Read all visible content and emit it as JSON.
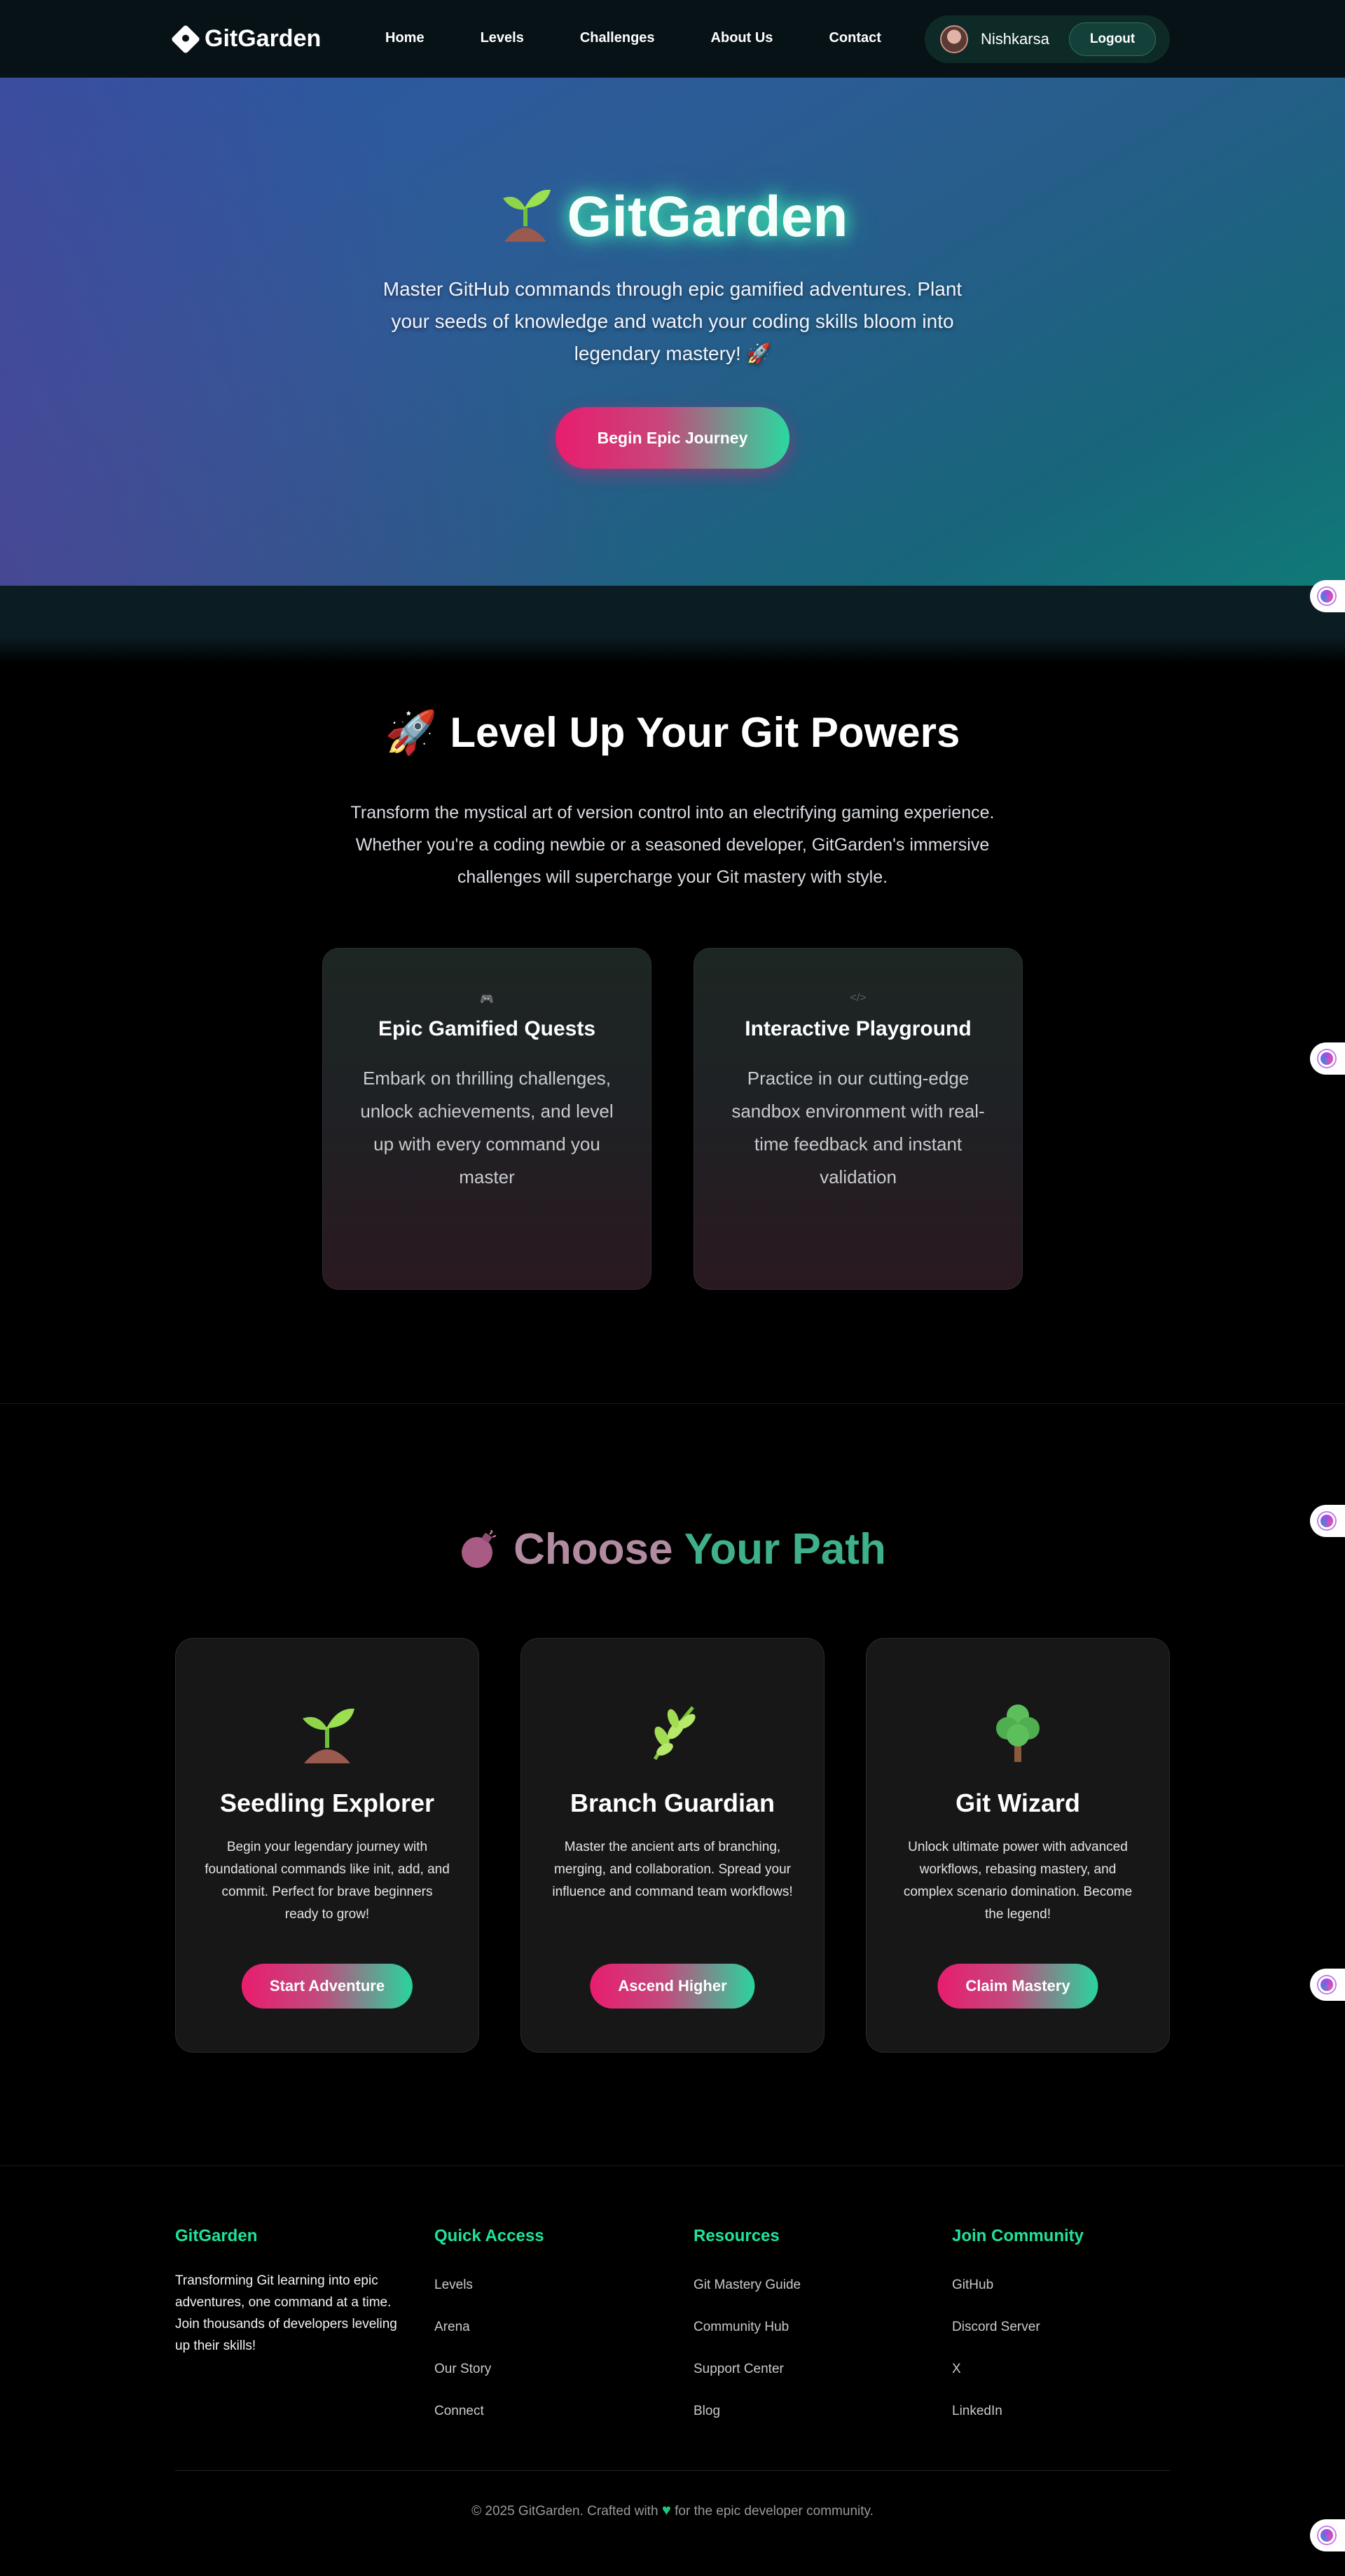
{
  "nav": {
    "brand": "GitGarden",
    "links": [
      "Home",
      "Levels",
      "Challenges",
      "About Us",
      "Contact"
    ],
    "user_name": "Nishkarsa",
    "logout_label": "Logout"
  },
  "hero": {
    "title": "GitGarden",
    "subtitle": "Master GitHub commands through epic gamified adventures. Plant your seeds of knowledge and watch your coding skills bloom into legendary mastery! 🚀",
    "cta_label": "Begin Epic Journey"
  },
  "level_up": {
    "title_emoji": "🚀",
    "title": "Level Up Your Git Powers",
    "description": "Transform the mystical art of version control into an electrifying gaming experience. Whether you're a coding newbie or a seasoned developer, GitGarden's immersive challenges will supercharge your Git mastery with style.",
    "features": [
      {
        "icon": "gamepad-icon",
        "glyph": "🎮",
        "title": "Epic Gamified Quests",
        "description": "Embark on thrilling challenges, unlock achievements, and level up with every command you master"
      },
      {
        "icon": "code-icon",
        "glyph": "</>",
        "title": "Interactive Playground",
        "description": "Practice in our cutting-edge sandbox environment with real-time feedback and instant validation"
      }
    ]
  },
  "paths": {
    "title_word1": "Choose",
    "title_word2": "Your Path",
    "cards": [
      {
        "icon": "seedling-icon",
        "title": "Seedling Explorer",
        "description": "Begin your legendary journey with foundational commands like init, add, and commit. Perfect for brave beginners ready to grow!",
        "button": "Start Adventure"
      },
      {
        "icon": "herb-icon",
        "title": "Branch Guardian",
        "description": "Master the ancient arts of branching, merging, and collaboration. Spread your influence and command team workflows!",
        "button": "Ascend Higher"
      },
      {
        "icon": "tree-icon",
        "title": "Git Wizard",
        "description": "Unlock ultimate power with advanced workflows, rebasing mastery, and complex scenario domination. Become the legend!",
        "button": "Claim Mastery"
      }
    ]
  },
  "footer": {
    "brand": "GitGarden",
    "tagline": "Transforming Git learning into epic adventures, one command at a time. Join thousands of developers leveling up their skills!",
    "quick_access": {
      "heading": "Quick Access",
      "links": [
        "Levels",
        "Arena",
        "Our Story",
        "Connect"
      ]
    },
    "resources": {
      "heading": "Resources",
      "links": [
        "Git Mastery Guide",
        "Community Hub",
        "Support Center",
        "Blog"
      ]
    },
    "community": {
      "heading": "Join Community",
      "links": [
        "GitHub",
        "Discord Server",
        "X",
        "LinkedIn"
      ]
    },
    "copyright_pre": "© 2025 GitGarden. Crafted with",
    "copyright_post": "for the epic developer community."
  },
  "colors": {
    "accent_green": "#20e39a",
    "accent_pink": "#e81d6e",
    "card_bg": "#171717"
  }
}
